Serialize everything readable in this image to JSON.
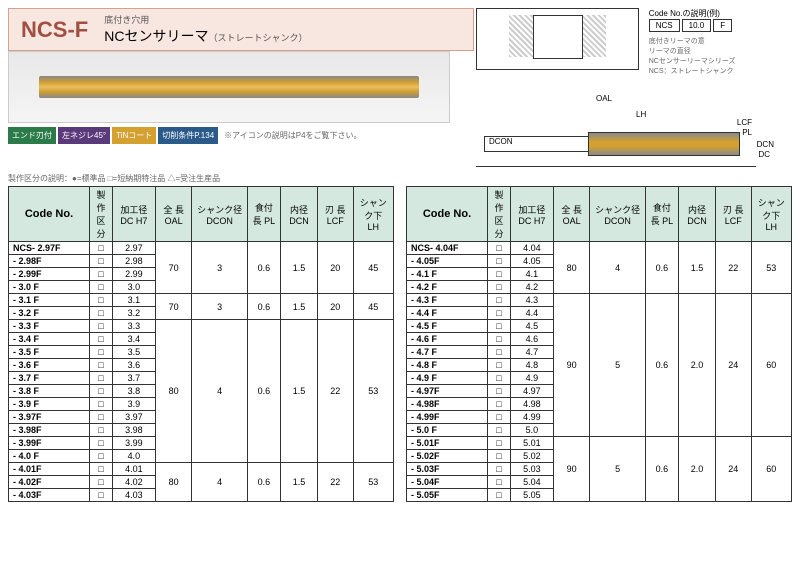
{
  "header": {
    "code": "NCS-F",
    "jp_sub": "底付き穴用",
    "jp_title": "NCセンサリーマ",
    "jp_paren": "（ストレートシャンク）"
  },
  "badges": {
    "b1": "エンド刃付",
    "b2": "左ネジレ45°",
    "b3": "TiNコート",
    "b4": "切削条件P.134",
    "note": "※アイコンの説明はP4をご覧下さい。"
  },
  "code_example": {
    "label": "Code No.の説明(例)",
    "p1": "NCS",
    "p2": "10.0",
    "p3": "F",
    "n1": "底付きリーマの意",
    "n2": "リーマの直径",
    "n3": "NCセンサーリーマシリーズ NCS：ストレートシャンク"
  },
  "drawing": {
    "oal": "OAL",
    "lh": "LH",
    "dcon": "DCON",
    "dc": "DC",
    "dcn": "DCN",
    "lcf": "LCF",
    "pl": "PL"
  },
  "legend": "製作区分の説明：●=標準品 □=短納期特注品 △=受注生産品",
  "cols": {
    "code": "Code No.",
    "seizo": "製作区分",
    "dc": "加工径 DC H7",
    "oal": "全 長 OAL",
    "dcon": "シャンク径 DCON",
    "pl": "食付長 PL",
    "dcn": "内径 DCN",
    "lcf": "刃 長 LCF",
    "lh": "シャンク下 LH"
  },
  "table1": {
    "groups": [
      {
        "oal": "70",
        "dcon": "3",
        "pl": "0.6",
        "dcn": "1.5",
        "lcf": "20",
        "lh": "45",
        "rows": [
          {
            "code": "NCS- 2.97F",
            "dc": "2.97"
          },
          {
            "code": "- 2.98F",
            "dc": "2.98"
          },
          {
            "code": "- 2.99F",
            "dc": "2.99"
          },
          {
            "code": "- 3.0 F",
            "dc": "3.0"
          }
        ]
      },
      {
        "oal": "70",
        "dcon": "3",
        "pl": "0.6",
        "dcn": "1.5",
        "lcf": "20",
        "lh": "45",
        "rows": [
          {
            "code": "- 3.1 F",
            "dc": "3.1"
          },
          {
            "code": "- 3.2 F",
            "dc": "3.2"
          }
        ]
      },
      {
        "oal": "80",
        "dcon": "4",
        "pl": "0.6",
        "dcn": "1.5",
        "lcf": "22",
        "lh": "53",
        "rows": [
          {
            "code": "- 3.3 F",
            "dc": "3.3"
          },
          {
            "code": "- 3.4 F",
            "dc": "3.4"
          },
          {
            "code": "- 3.5 F",
            "dc": "3.5"
          },
          {
            "code": "- 3.6 F",
            "dc": "3.6"
          },
          {
            "code": "- 3.7 F",
            "dc": "3.7"
          },
          {
            "code": "- 3.8 F",
            "dc": "3.8"
          },
          {
            "code": "- 3.9 F",
            "dc": "3.9"
          },
          {
            "code": "- 3.97F",
            "dc": "3.97"
          },
          {
            "code": "- 3.98F",
            "dc": "3.98"
          },
          {
            "code": "- 3.99F",
            "dc": "3.99"
          },
          {
            "code": "- 4.0 F",
            "dc": "4.0"
          }
        ]
      },
      {
        "oal": "80",
        "dcon": "4",
        "pl": "0.6",
        "dcn": "1.5",
        "lcf": "22",
        "lh": "53",
        "rows": [
          {
            "code": "- 4.01F",
            "dc": "4.01"
          },
          {
            "code": "- 4.02F",
            "dc": "4.02"
          },
          {
            "code": "- 4.03F",
            "dc": "4.03"
          }
        ]
      }
    ]
  },
  "table2": {
    "groups": [
      {
        "oal": "80",
        "dcon": "4",
        "pl": "0.6",
        "dcn": "1.5",
        "lcf": "22",
        "lh": "53",
        "rows": [
          {
            "code": "NCS- 4.04F",
            "dc": "4.04"
          },
          {
            "code": "- 4.05F",
            "dc": "4.05"
          },
          {
            "code": "- 4.1 F",
            "dc": "4.1"
          },
          {
            "code": "- 4.2 F",
            "dc": "4.2"
          }
        ]
      },
      {
        "oal": "90",
        "dcon": "5",
        "pl": "0.6",
        "dcn": "2.0",
        "lcf": "24",
        "lh": "60",
        "rows": [
          {
            "code": "- 4.3 F",
            "dc": "4.3"
          },
          {
            "code": "- 4.4 F",
            "dc": "4.4"
          },
          {
            "code": "- 4.5 F",
            "dc": "4.5"
          },
          {
            "code": "- 4.6 F",
            "dc": "4.6"
          },
          {
            "code": "- 4.7 F",
            "dc": "4.7"
          },
          {
            "code": "- 4.8 F",
            "dc": "4.8"
          },
          {
            "code": "- 4.9 F",
            "dc": "4.9"
          },
          {
            "code": "- 4.97F",
            "dc": "4.97"
          },
          {
            "code": "- 4.98F",
            "dc": "4.98"
          },
          {
            "code": "- 4.99F",
            "dc": "4.99"
          },
          {
            "code": "- 5.0 F",
            "dc": "5.0"
          }
        ]
      },
      {
        "oal": "90",
        "dcon": "5",
        "pl": "0.6",
        "dcn": "2.0",
        "lcf": "24",
        "lh": "60",
        "rows": [
          {
            "code": "- 5.01F",
            "dc": "5.01"
          },
          {
            "code": "- 5.02F",
            "dc": "5.02"
          },
          {
            "code": "- 5.03F",
            "dc": "5.03"
          },
          {
            "code": "- 5.04F",
            "dc": "5.04"
          },
          {
            "code": "- 5.05F",
            "dc": "5.05"
          }
        ]
      }
    ]
  }
}
